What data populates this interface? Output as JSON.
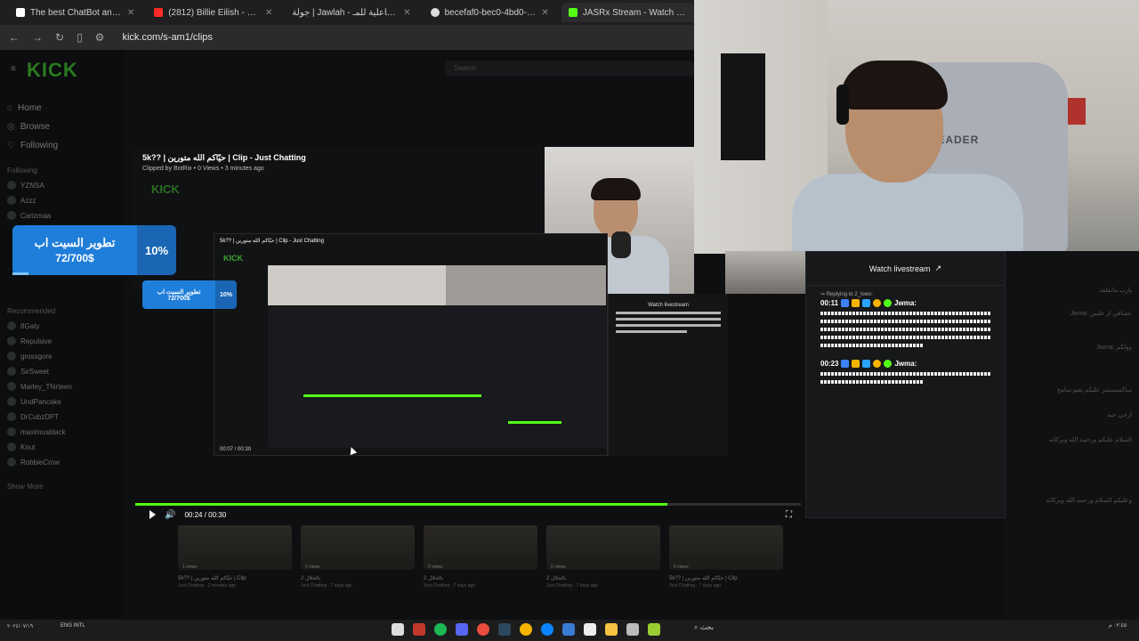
{
  "browser": {
    "tabs": [
      {
        "title": "The best ChatBot and Widgets for Kick, Tw",
        "color": "#ffffff"
      },
      {
        "title": "(2812) Billie Eilish - CHIHIRO (Official Mu",
        "color": "#ff2b2b"
      },
      {
        "title": "جولة | Jawlah - منصة الألعاب التفاعلية للمـ",
        "color": "#cccccc"
      },
      {
        "title": "becefaf0-bec0-4bd0-8cca-8808b1b539c",
        "color": "#dddddd"
      },
      {
        "title": "JASRx Stream - Watch Live on Kick",
        "color": "#53fc18"
      }
    ],
    "url": "kick.com/s-am1/clips"
  },
  "kick": {
    "logo": "KICK",
    "search_placeholder": "Search",
    "nav": [
      {
        "label": "Home",
        "icon": "home-icon"
      },
      {
        "label": "Browse",
        "icon": "compass-icon"
      },
      {
        "label": "Following",
        "icon": "heart-icon"
      }
    ],
    "following_header": "Following",
    "following": [
      "YZNSA",
      "Azzz",
      "Carizmaa"
    ],
    "recommended_header": "Recommended",
    "recommended": [
      "8Gaty",
      "Repulsive",
      "grossgore",
      "SirSweet",
      "Marley_Thirteen",
      "UndPancake",
      "DrCubzDPT",
      "maximusblack",
      "Knut",
      "RobbieCrow"
    ],
    "show_more": "Show More"
  },
  "clip": {
    "title": "5k?? | حيّاكم الله متورين | Clip - Just Chatting",
    "meta": "Clipped by BotRix • 0 Views • 3 minutes ago",
    "time": "00:24 / 00:30",
    "progress": 0.8,
    "nested_time": "00:07 / 00:30"
  },
  "goal": {
    "title": "تطوير السيت اب",
    "amount": "72/700$",
    "percent": "10%",
    "fill": 0.1
  },
  "chat": {
    "header": "Watch livestream",
    "reply_to": "Replying to 2_lowx:",
    "messages": [
      {
        "time": "00:11",
        "user": "Jwma:",
        "lines": 5
      },
      {
        "time": "00:23",
        "user": "Jwma:",
        "lines": 2
      }
    ]
  },
  "right_chat": {
    "lines": [
      "پارب مانفلقد",
      "Jwma: عشاقي از خليين",
      "Jwma: وولكم",
      "ساكسسسر عليكم بعيو سامح",
      "ارحي حبه",
      "السلام عليكم ورحمة الله وبركاته",
      "وعليكم السلام ورحمه الله وبركاته"
    ]
  },
  "thumbs": [
    {
      "title": "5k?? | حيّاكم الله متورين | Clip",
      "sub": "Just Chatting - 2 minutes ago",
      "views": "1 views"
    },
    {
      "title": "بالحلال 2",
      "sub": "Just Chatting - 7 days ago",
      "views": "0 views"
    },
    {
      "title": "بالحلال 2",
      "sub": "Just Chatting - 7 days ago",
      "views": "0 views"
    },
    {
      "title": "بالحلال 2",
      "sub": "Just Chatting - 7 days ago",
      "views": "0 views"
    },
    {
      "title": "5k?? | حيّاكم الله متورين | Clip",
      "sub": "Just Chatting - 7 days ago",
      "views": "0 views"
    }
  ],
  "taskbar": {
    "lang": "ENG\nINTL",
    "search": "بحث",
    "clock": "٠٢:٤٥ م",
    "date": "٢٠٢٤/٠٧/١٩"
  }
}
